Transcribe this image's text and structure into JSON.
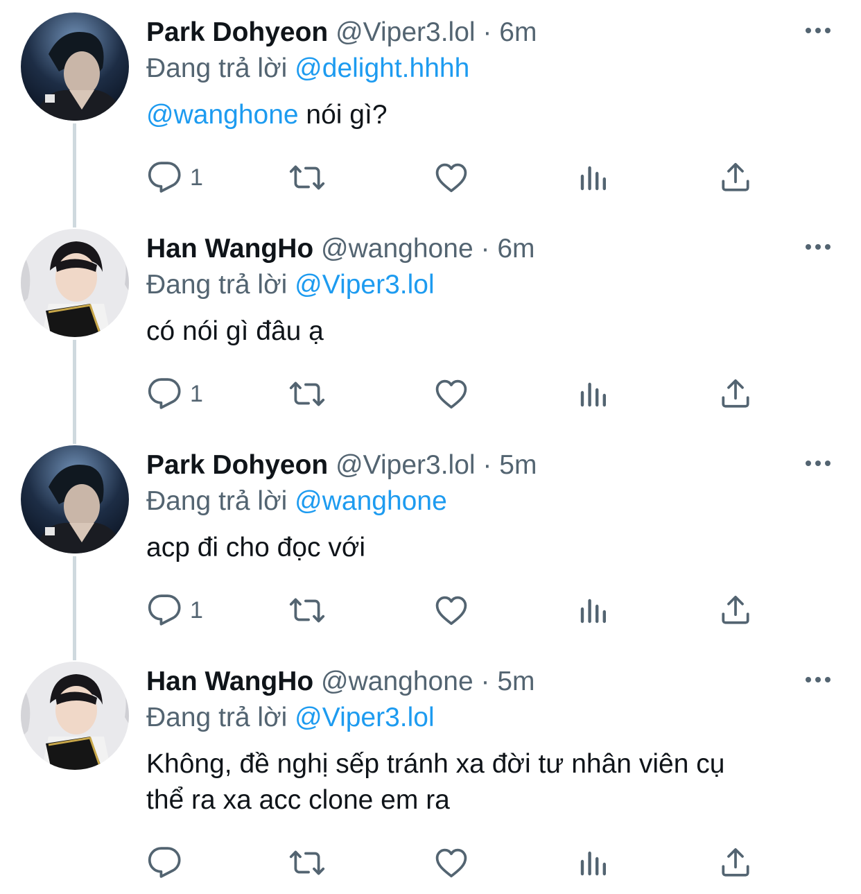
{
  "tweets": [
    {
      "name": "Park Dohyeon",
      "handle": "@Viper3.lol",
      "sep": "·",
      "time": "6m",
      "reply_prefix": "Đang trả lời",
      "reply_to": "@delight.hhhh",
      "mention": "@wanghone",
      "text": " nói gì?",
      "reply_count": "1",
      "avatar": "park-dohyeon-avatar"
    },
    {
      "name": "Han WangHo",
      "handle": "@wanghone",
      "sep": "·",
      "time": "6m",
      "reply_prefix": "Đang trả lời",
      "reply_to": "@Viper3.lol",
      "text": "có nói gì đâu ạ",
      "reply_count": "1",
      "avatar": "han-wangho-avatar"
    },
    {
      "name": "Park Dohyeon",
      "handle": "@Viper3.lol",
      "sep": "·",
      "time": "5m",
      "reply_prefix": "Đang trả lời",
      "reply_to": "@wanghone",
      "text": "acp đi cho đọc với",
      "reply_count": "1",
      "avatar": "park-dohyeon-avatar"
    },
    {
      "name": "Han WangHo",
      "handle": "@wanghone",
      "sep": "·",
      "time": "5m",
      "reply_prefix": "Đang trả lời",
      "reply_to": "@Viper3.lol",
      "text_line1": "Không, đề nghị sếp tránh xa đời tư nhân viên cụ",
      "text_line2": "thể ra xa acc clone em ra",
      "reply_count": "",
      "avatar": "han-wangho-avatar"
    }
  ],
  "colors": {
    "text": "#0f1419",
    "secondary": "#536471",
    "link": "#1d9bf0",
    "thread_line": "#cfd9de"
  },
  "icons": [
    "reply-icon",
    "retweet-icon",
    "like-icon",
    "views-icon",
    "share-icon",
    "more-icon"
  ]
}
